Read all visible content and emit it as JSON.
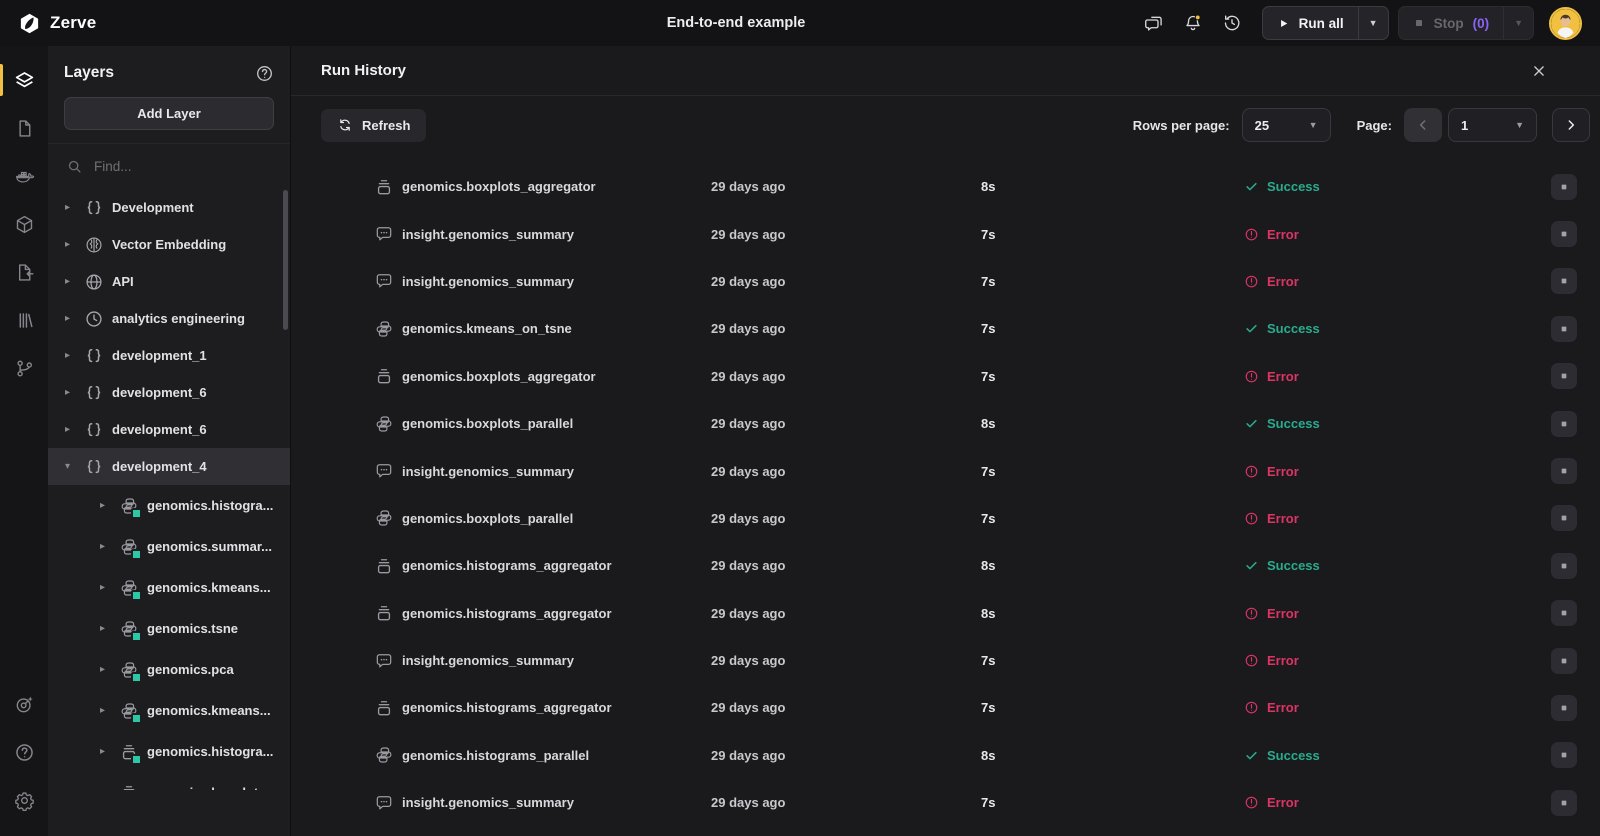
{
  "topbar": {
    "logo_text": "Zerve",
    "title": "End-to-end example",
    "run_all_label": "Run all",
    "stop_label": "Stop",
    "stop_count": "(0)"
  },
  "rail": {
    "top": [
      {
        "icon": "layers",
        "active": true
      },
      {
        "icon": "document"
      },
      {
        "icon": "docker"
      },
      {
        "icon": "package"
      },
      {
        "icon": "file-import"
      },
      {
        "icon": "library"
      },
      {
        "icon": "git-branch"
      }
    ],
    "bottom": [
      {
        "icon": "assistant-target"
      },
      {
        "icon": "help"
      },
      {
        "icon": "settings"
      }
    ]
  },
  "sidebar": {
    "title": "Layers",
    "add_layer_label": "Add Layer",
    "find_placeholder": "Find...",
    "tree": [
      {
        "label": "Development",
        "icon": "braces",
        "level": 0
      },
      {
        "label": "Vector Embedding",
        "icon": "brain",
        "level": 0
      },
      {
        "label": "API",
        "icon": "globe",
        "level": 0
      },
      {
        "label": "analytics engineering",
        "icon": "clock",
        "level": 0
      },
      {
        "label": "development_1",
        "icon": "braces",
        "level": 0
      },
      {
        "label": "development_6",
        "icon": "braces",
        "level": 0
      },
      {
        "label": "development_6",
        "icon": "braces",
        "level": 0
      },
      {
        "label": "development_4",
        "icon": "braces",
        "level": 0,
        "selected": true,
        "expanded": true
      },
      {
        "label": "genomics.histogra...",
        "icon": "python",
        "level": 1,
        "dot": true
      },
      {
        "label": "genomics.summar...",
        "icon": "python",
        "level": 1,
        "dot": true
      },
      {
        "label": "genomics.kmeans...",
        "icon": "python",
        "level": 1,
        "dot": true
      },
      {
        "label": "genomics.tsne",
        "icon": "python",
        "level": 1,
        "dot": true
      },
      {
        "label": "genomics.pca",
        "icon": "python",
        "level": 1,
        "dot": true
      },
      {
        "label": "genomics.kmeans...",
        "icon": "python",
        "level": 1,
        "dot": true
      },
      {
        "label": "genomics.histogra...",
        "icon": "aggregator",
        "level": 1,
        "dot": true
      },
      {
        "label": "genomics.boxplots...",
        "icon": "aggregator",
        "level": 1,
        "dot": true
      }
    ]
  },
  "panel": {
    "title": "Run History",
    "refresh_label": "Refresh",
    "rows_per_page_label": "Rows per page:",
    "rows_per_page_value": "25",
    "page_label": "Page:",
    "page_value": "1"
  },
  "run_history": {
    "rows": [
      {
        "name": "genomics.boxplots_aggregator",
        "icon": "aggregator",
        "when": "29 days ago",
        "duration": "8s",
        "status": "Success"
      },
      {
        "name": "insight.genomics_summary",
        "icon": "chat-bubble",
        "when": "29 days ago",
        "duration": "7s",
        "status": "Error"
      },
      {
        "name": "insight.genomics_summary",
        "icon": "chat-bubble",
        "when": "29 days ago",
        "duration": "7s",
        "status": "Error"
      },
      {
        "name": "genomics.kmeans_on_tsne",
        "icon": "python",
        "when": "29 days ago",
        "duration": "7s",
        "status": "Success"
      },
      {
        "name": "genomics.boxplots_aggregator",
        "icon": "aggregator",
        "when": "29 days ago",
        "duration": "7s",
        "status": "Error"
      },
      {
        "name": "genomics.boxplots_parallel",
        "icon": "python",
        "when": "29 days ago",
        "duration": "8s",
        "status": "Success"
      },
      {
        "name": "insight.genomics_summary",
        "icon": "chat-bubble",
        "when": "29 days ago",
        "duration": "7s",
        "status": "Error"
      },
      {
        "name": "genomics.boxplots_parallel",
        "icon": "python",
        "when": "29 days ago",
        "duration": "7s",
        "status": "Error"
      },
      {
        "name": "genomics.histograms_aggregator",
        "icon": "aggregator",
        "when": "29 days ago",
        "duration": "8s",
        "status": "Success"
      },
      {
        "name": "genomics.histograms_aggregator",
        "icon": "aggregator",
        "when": "29 days ago",
        "duration": "8s",
        "status": "Error"
      },
      {
        "name": "insight.genomics_summary",
        "icon": "chat-bubble",
        "when": "29 days ago",
        "duration": "7s",
        "status": "Error"
      },
      {
        "name": "genomics.histograms_aggregator",
        "icon": "aggregator",
        "when": "29 days ago",
        "duration": "7s",
        "status": "Error"
      },
      {
        "name": "genomics.histograms_parallel",
        "icon": "python",
        "when": "29 days ago",
        "duration": "8s",
        "status": "Success"
      },
      {
        "name": "insight.genomics_summary",
        "icon": "chat-bubble",
        "when": "29 days ago",
        "duration": "7s",
        "status": "Error"
      }
    ]
  },
  "colors": {
    "accent_yellow": "#f2c040",
    "success": "#2aab8e",
    "error": "#dc3564",
    "purple": "#8a63f5",
    "teal_dot": "#2cc8a5"
  }
}
